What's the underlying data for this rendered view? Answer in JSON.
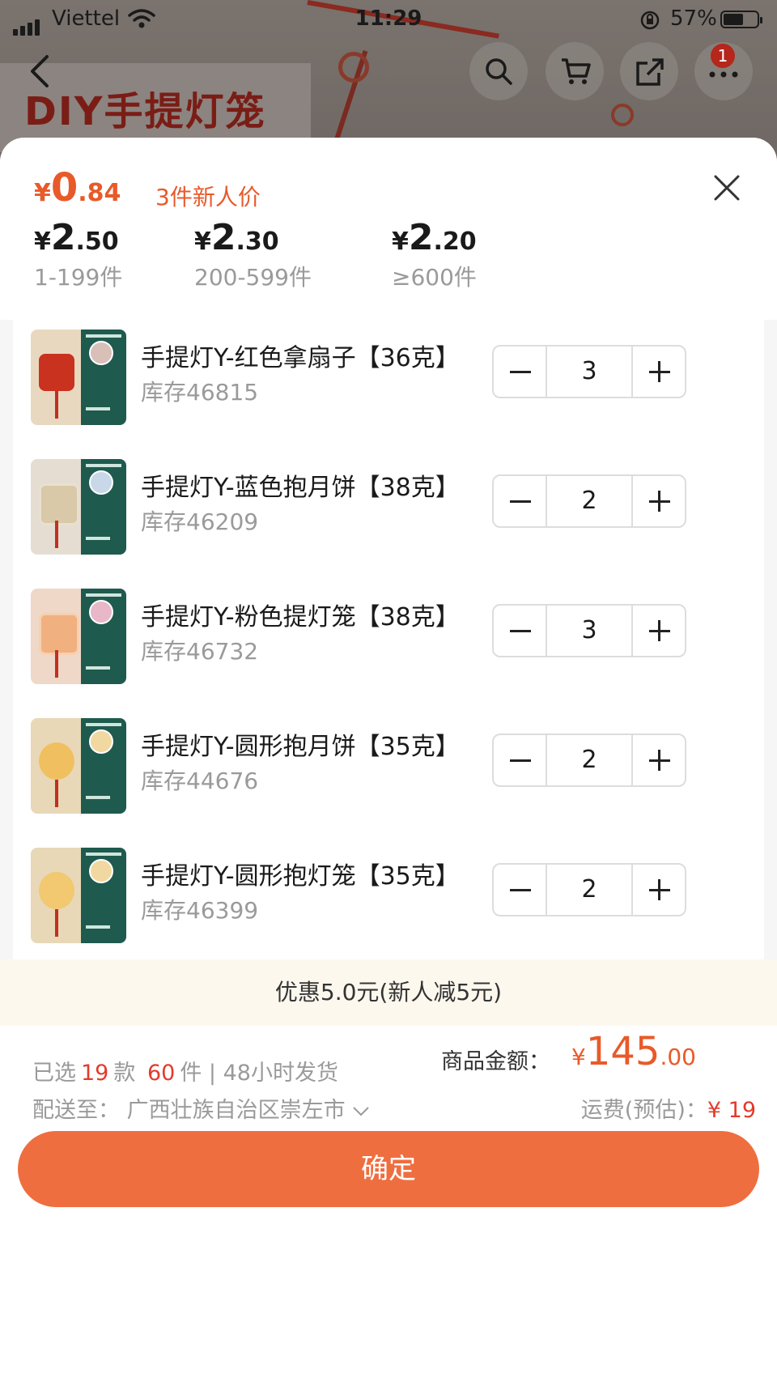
{
  "status_bar": {
    "carrier": "Viettel",
    "time": "11:29",
    "battery": "57%"
  },
  "background_page": {
    "banner_title": "DIY手提灯笼",
    "cart_badge": "1"
  },
  "price_panel": {
    "new_price": {
      "currency": "¥",
      "integer": "0",
      "decimal": ".84",
      "note": "3件新人价"
    },
    "tiers": [
      {
        "currency": "¥",
        "integer": "2",
        "decimal": ".50",
        "range": "1-199件"
      },
      {
        "currency": "¥",
        "integer": "2",
        "decimal": ".30",
        "range": "200-599件"
      },
      {
        "currency": "¥",
        "integer": "2",
        "decimal": ".20",
        "range": "≥600件"
      }
    ]
  },
  "items": [
    {
      "name": "手提灯Y-红色拿扇子【36克】",
      "stock": "库存46815",
      "qty": "3",
      "color": "#c8321f"
    },
    {
      "name": "手提灯Y-蓝色抱月饼【38克】",
      "stock": "库存46209",
      "qty": "2",
      "color": "#7aa7c9"
    },
    {
      "name": "手提灯Y-粉色提灯笼【38克】",
      "stock": "库存46732",
      "qty": "3",
      "color": "#e8a0a8"
    },
    {
      "name": "手提灯Y-圆形抱月饼【35克】",
      "stock": "库存44676",
      "qty": "2",
      "color": "#f0c060"
    },
    {
      "name": "手提灯Y-圆形抱灯笼【35克】",
      "stock": "库存46399",
      "qty": "2",
      "color": "#f2c870"
    }
  ],
  "discount_text": "优惠5.0元(新人减5元)",
  "footer": {
    "selected_prefix": "已选",
    "selected_styles": "19",
    "styles_unit": "款",
    "selected_count": "60",
    "count_unit": "件",
    "ship_time": "| 48小时发货",
    "ship_to_label": "配送至：",
    "ship_to_value": "广西壮族自治区崇左市",
    "amount_label": "商品金额：",
    "amount": {
      "currency": "¥",
      "integer": "145",
      "decimal": ".00"
    },
    "freight_label": "运费(预估)：",
    "freight_value": "¥ 19",
    "confirm_label": "确定"
  },
  "colors": {
    "accent": "#ef6e3f",
    "price_red": "#e85a2a",
    "count_red": "#e23b2b",
    "discount_bg": "#fcf8ee"
  }
}
